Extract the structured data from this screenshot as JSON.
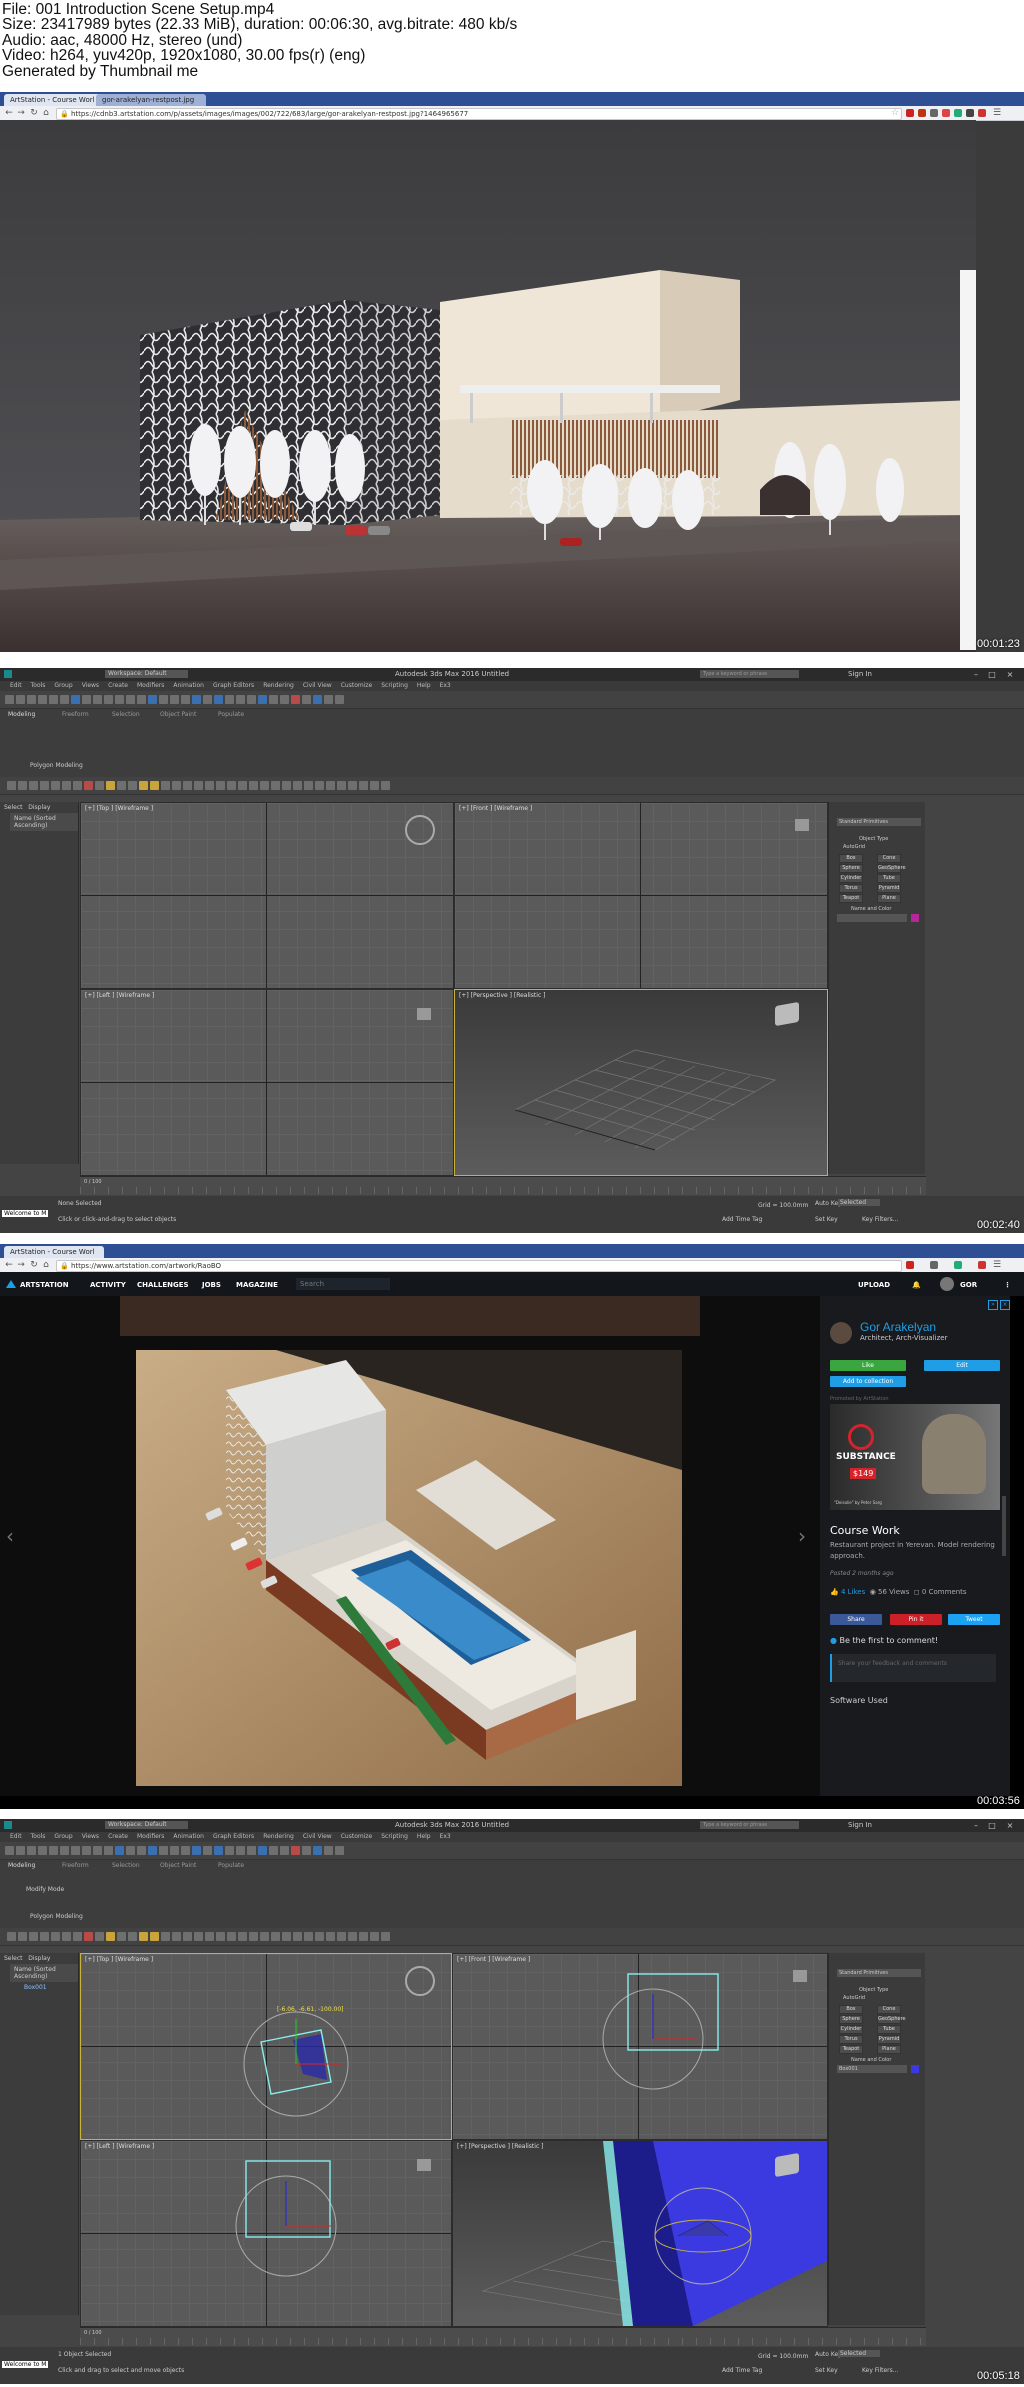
{
  "info": {
    "file": "File: 001 Introduction  Scene Setup.mp4",
    "size": "Size: 23417989 bytes (22.33 MiB), duration: 00:06:30, avg.bitrate: 480 kb/s",
    "audio": "Audio: aac, 48000 Hz, stereo (und)",
    "video": "Video: h264, yuv420p, 1920x1080, 30.00 fps(r) (eng)",
    "generated": "Generated by Thumbnail me"
  },
  "timestamps": [
    "00:01:23",
    "00:02:40",
    "00:03:56",
    "00:05:18"
  ],
  "browser1": {
    "tab1": "ArtStation - Course Worl",
    "tab2": "gor-arakelyan-restpost.jpg",
    "url": "https://cdnb3.artstation.com/p/assets/images/images/002/722/683/large/gor-arakelyan-restpost.jpg?1464965677"
  },
  "max": {
    "title": "Autodesk 3ds Max 2016    Untitled",
    "workspace": "Workspace: Default",
    "search_placeholder": "Type a keyword or phrase",
    "sign_in": "Sign In",
    "menus": [
      "Edit",
      "Tools",
      "Group",
      "Views",
      "Create",
      "Modifiers",
      "Animation",
      "Graph Editors",
      "Rendering",
      "Civil View",
      "Customize",
      "Scripting",
      "Help",
      "Ex3"
    ],
    "ribbon_tabs": [
      "Modeling",
      "Freeform",
      "Selection",
      "Object Paint",
      "Populate"
    ],
    "polygon_modeling": "Polygon Modeling",
    "modify_mode": "Modify Mode",
    "scene_tabs": [
      "Select",
      "Display"
    ],
    "scene_header": "Name (Sorted Ascending)",
    "scene_item": "Box001",
    "viewports": {
      "top": "[+] [Top ] [Wireframe ]",
      "front": "[+] [Front ] [Wireframe ]",
      "left": "[+] [Left ] [Wireframe ]",
      "persp": "[+] [Perspective ] [Realistic ]"
    },
    "transform_readout": "[-6.06, -6.61, -100.00]",
    "standard_primitives": "Standard Primitives",
    "object_type": "Object Type",
    "autogrid": "AutoGrid",
    "primitives": [
      "Box",
      "Cone",
      "Sphere",
      "GeoSphere",
      "Cylinder",
      "Tube",
      "Torus",
      "Pyramid",
      "Teapot",
      "Plane"
    ],
    "name_and_color": "Name and Color",
    "name_value": "Box001",
    "frame": "0 / 100",
    "status1": "None Selected",
    "status2": "1 Object Selected",
    "prompt1": "Click or click-and-drag to select objects",
    "prompt2": "Click and drag to select and move objects",
    "grid": "Grid = 100.0mm",
    "auto_key": "Auto Key",
    "set_key": "Set Key",
    "selected": "Selected",
    "key_filters": "Key Filters...",
    "add_time_tag": "Add Time Tag",
    "welcome": "Welcome to M"
  },
  "browser2": {
    "tab1": "ArtStation - Course Worl",
    "url": "https://www.artstation.com/artwork/RaoBO"
  },
  "artstation": {
    "logo": "ARTSTATION",
    "nav": [
      "ACTIVITY",
      "CHALLENGES",
      "JOBS",
      "MAGAZINE"
    ],
    "search": "Search",
    "upload": "UPLOAD",
    "user": "GOR",
    "artist_name": "Gor Arakelyan",
    "artist_title": "Architect, Arch-Visualizer",
    "like": "Like",
    "edit": "Edit",
    "add_collection": "Add to collection",
    "promo_label": "Promoted by ArtStation",
    "promo_brand": "SUBSTANCE",
    "promo_price": "$149",
    "promo_caption": "\"Deisolie\" by Peter Sarg",
    "work_title": "Course Work",
    "description": "Restaurant project in Yerevan. Model rendering approach.",
    "posted": "Posted 2 months ago",
    "likes": "4 Likes",
    "views": "56 Views",
    "comments": "0 Comments",
    "share": "Share",
    "pin": "Pin it",
    "tweet": "Tweet",
    "first_comment": "Be the first to comment!",
    "comment_placeholder": "Share your feedback and comments",
    "software_used": "Software Used"
  },
  "colors": {
    "chrome_tab": "#2f4f94",
    "max_bg": "#444444",
    "viewport": "#5a5a5a",
    "artstation_nav": "#13171c",
    "like_green": "#3aa640",
    "edit_blue": "#1f9ee6",
    "artist_name": "#1f9ee6"
  }
}
